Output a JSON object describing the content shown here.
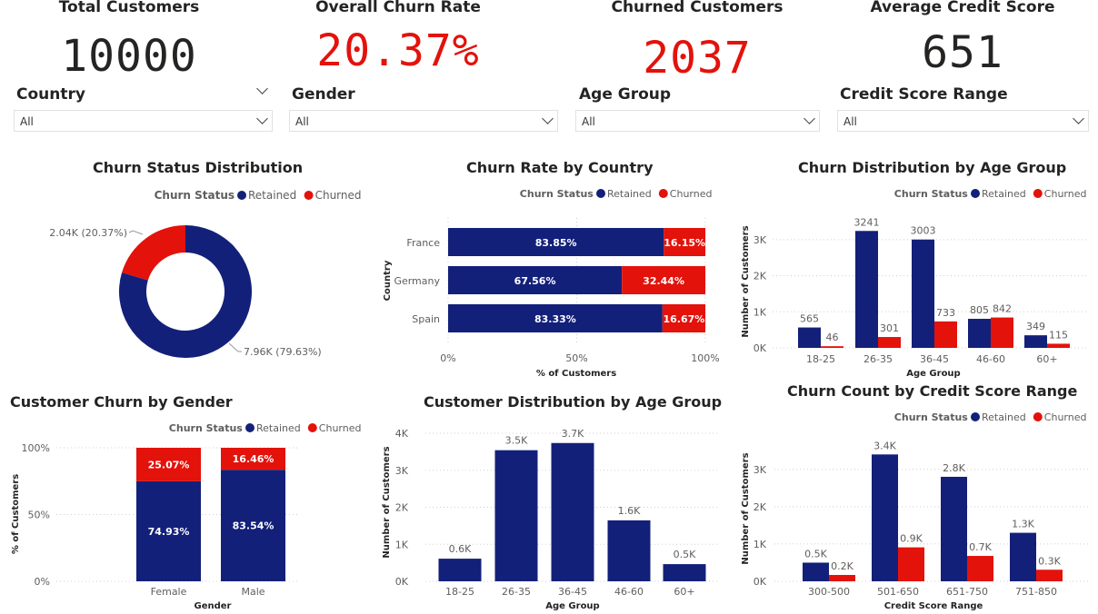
{
  "colors": {
    "retained": "#13207A",
    "churned": "#E3120B",
    "grid": "#d0d0d0",
    "text": "#252423",
    "axis": "#605e5c"
  },
  "kpis": [
    {
      "title": "Total Customers",
      "value": "10000",
      "color": "#252423"
    },
    {
      "title": "Overall Churn Rate",
      "value": "20.37%",
      "color": "#E3120B"
    },
    {
      "title": "Churned Customers",
      "value": "2037",
      "color": "#E3120B"
    },
    {
      "title": "Average Credit Score",
      "value": "651",
      "color": "#252423"
    }
  ],
  "slicers": [
    {
      "label": "Country",
      "value": "All"
    },
    {
      "label": "Gender",
      "value": "All"
    },
    {
      "label": "Age Group",
      "value": "All"
    },
    {
      "label": "Credit Score Range",
      "value": "All"
    }
  ],
  "legend": {
    "title": "Churn Status",
    "retained": "Retained",
    "churned": "Churned"
  },
  "chart_data": [
    {
      "id": "donut",
      "type": "pie",
      "title": "Churn Status Distribution",
      "slices": [
        {
          "name": "Retained",
          "value": 79.63,
          "label": "7.96K (79.63%)"
        },
        {
          "name": "Churned",
          "value": 20.37,
          "label": "2.04K (20.37%)"
        }
      ],
      "legend_position": "top"
    },
    {
      "id": "country",
      "type": "bar",
      "orientation": "horizontal-stacked-100",
      "title": "Churn Rate by Country",
      "categories": [
        "France",
        "Germany",
        "Spain"
      ],
      "series": [
        {
          "name": "Retained",
          "values": [
            83.85,
            67.56,
            83.33
          ]
        },
        {
          "name": "Churned",
          "values": [
            16.15,
            32.44,
            16.67
          ]
        }
      ],
      "xlabel": "% of Customers",
      "ylabel": "Country",
      "xticks": [
        "0%",
        "50%",
        "100%"
      ],
      "legend_position": "top-right"
    },
    {
      "id": "agegroup",
      "type": "bar",
      "orientation": "vertical-clustered",
      "title": "Churn Distribution by Age Group",
      "categories": [
        "18-25",
        "26-35",
        "36-45",
        "46-60",
        "60+"
      ],
      "series": [
        {
          "name": "Retained",
          "values": [
            565,
            3241,
            3003,
            805,
            349
          ]
        },
        {
          "name": "Churned",
          "values": [
            46,
            301,
            733,
            842,
            115
          ]
        }
      ],
      "xlabel": "Age Group",
      "ylabel": "Number of Customers",
      "ylim": [
        0,
        3600
      ],
      "yticks": [
        {
          "v": 0,
          "t": "0K"
        },
        {
          "v": 1000,
          "t": "1K"
        },
        {
          "v": 2000,
          "t": "2K"
        },
        {
          "v": 3000,
          "t": "3K"
        }
      ],
      "legend_position": "top-right"
    },
    {
      "id": "gender",
      "type": "bar",
      "orientation": "vertical-stacked-100",
      "title": "Customer Churn by Gender",
      "categories": [
        "Female",
        "Male"
      ],
      "series": [
        {
          "name": "Retained",
          "values": [
            74.93,
            83.54
          ]
        },
        {
          "name": "Churned",
          "values": [
            25.07,
            16.46
          ]
        }
      ],
      "xlabel": "Gender",
      "ylabel": "% of Customers",
      "yticks": [
        {
          "v": 0,
          "t": "0%"
        },
        {
          "v": 50,
          "t": "50%"
        },
        {
          "v": 100,
          "t": "100%"
        }
      ],
      "legend_position": "top-right"
    },
    {
      "id": "custage",
      "type": "bar",
      "orientation": "vertical",
      "title": "Customer Distribution by Age Group",
      "categories": [
        "18-25",
        "26-35",
        "36-45",
        "46-60",
        "60+"
      ],
      "values": [
        611,
        3542,
        3736,
        1647,
        464
      ],
      "labels": [
        "0.6K",
        "3.5K",
        "3.7K",
        "1.6K",
        "0.5K"
      ],
      "xlabel": "Age Group",
      "ylabel": "Number of Customers",
      "ylim": [
        0,
        4000
      ],
      "yticks": [
        {
          "v": 0,
          "t": "0K"
        },
        {
          "v": 1000,
          "t": "1K"
        },
        {
          "v": 2000,
          "t": "2K"
        },
        {
          "v": 3000,
          "t": "3K"
        },
        {
          "v": 4000,
          "t": "4K"
        }
      ]
    },
    {
      "id": "credit",
      "type": "bar",
      "orientation": "vertical-clustered",
      "title": "Churn Count by Credit Score Range",
      "categories": [
        "300-500",
        "501-650",
        "651-750",
        "751-850"
      ],
      "series": [
        {
          "name": "Retained",
          "values": [
            500,
            3400,
            2800,
            1300
          ],
          "labels": [
            "0.5K",
            "3.4K",
            "2.8K",
            "1.3K"
          ]
        },
        {
          "name": "Churned",
          "values": [
            170,
            910,
            680,
            310
          ],
          "labels": [
            "0.2K",
            "0.9K",
            "0.7K",
            "0.3K"
          ]
        }
      ],
      "xlabel": "Credit Score Range",
      "ylabel": "Number of Customers",
      "ylim": [
        0,
        3700
      ],
      "yticks": [
        {
          "v": 0,
          "t": "0K"
        },
        {
          "v": 1000,
          "t": "1K"
        },
        {
          "v": 2000,
          "t": "2K"
        },
        {
          "v": 3000,
          "t": "3K"
        }
      ],
      "legend_position": "top-right"
    }
  ]
}
